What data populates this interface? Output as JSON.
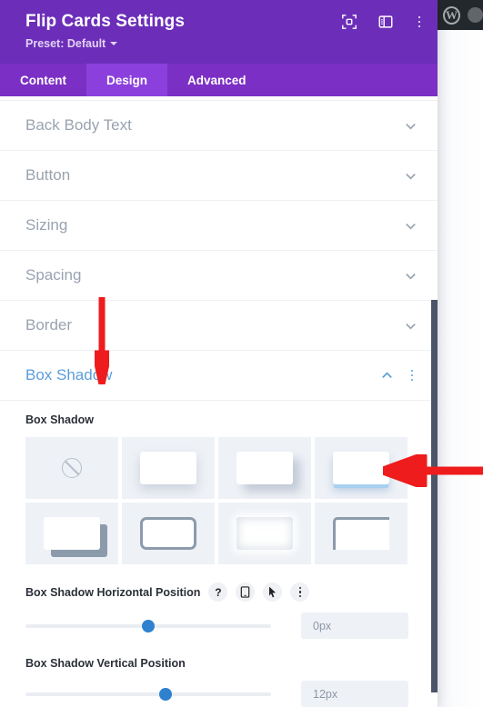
{
  "header": {
    "title": "Flip Cards Settings",
    "preset_label": "Preset: Default",
    "icons": [
      {
        "name": "focus-mode-icon"
      },
      {
        "name": "split-view-icon"
      },
      {
        "name": "more-options-icon"
      }
    ]
  },
  "tabs": [
    {
      "label": "Content",
      "active": false
    },
    {
      "label": "Design",
      "active": true
    },
    {
      "label": "Advanced",
      "active": false
    }
  ],
  "accordion": [
    {
      "label": "Back Body Text",
      "open": false
    },
    {
      "label": "Button",
      "open": false
    },
    {
      "label": "Sizing",
      "open": false
    },
    {
      "label": "Spacing",
      "open": false
    },
    {
      "label": "Border",
      "open": false
    },
    {
      "label": "Box Shadow",
      "open": true
    }
  ],
  "box_shadow": {
    "field_label": "Box Shadow",
    "presets": [
      {
        "name": "no-shadow",
        "selected": false
      },
      {
        "name": "soft-drop-shadow",
        "selected": false
      },
      {
        "name": "offset-blur-shadow",
        "selected": false
      },
      {
        "name": "bottom-glow-shadow",
        "selected": true
      },
      {
        "name": "hard-offset-shadow",
        "selected": false
      },
      {
        "name": "outline-shadow",
        "selected": false
      },
      {
        "name": "inner-shadow",
        "selected": false
      },
      {
        "name": "corner-bracket-shadow",
        "selected": false
      }
    ],
    "sliders": [
      {
        "label": "Box Shadow Horizontal Position",
        "value": "0px",
        "percent": 50,
        "icons": [
          {
            "name": "help-icon",
            "glyph": "?"
          },
          {
            "name": "responsive-mobile-icon"
          },
          {
            "name": "hover-cursor-icon"
          },
          {
            "name": "more-options-icon"
          }
        ]
      },
      {
        "label": "Box Shadow Vertical Position",
        "value": "12px",
        "percent": 57,
        "icons": []
      }
    ]
  },
  "colors": {
    "header_purple": "#6c2eb9",
    "tabbar_purple": "#7b2fc4",
    "active_tab_purple": "#8b40dd",
    "accent_blue": "#5b9dd9",
    "slider_blue": "#2f81d0",
    "annotation_red": "#ee1c1c",
    "scrollbar": "#4a5568"
  }
}
